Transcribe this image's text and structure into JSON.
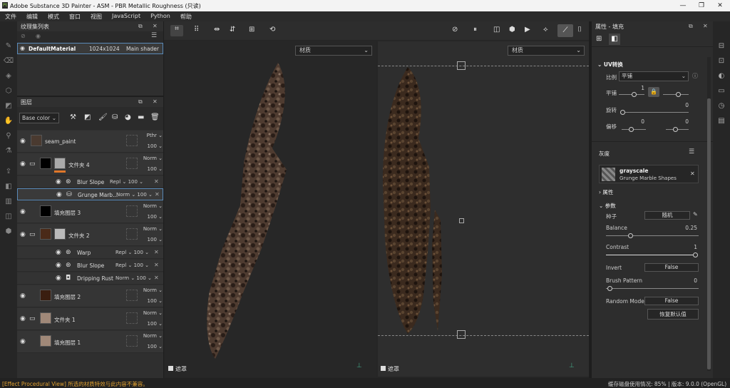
{
  "app": {
    "title": "Adobe Substance 3D Painter - ASM - PBR Metallic Roughness (只读)"
  },
  "menu": [
    "文件",
    "编辑",
    "模式",
    "窗口",
    "视图",
    "JavaScript",
    "Python",
    "帮助"
  ],
  "texture_set_panel": {
    "title": "纹理集列表",
    "row": {
      "name": "DefaultMaterial",
      "size": "1024x1024",
      "shader": "Main shader"
    }
  },
  "layers_panel": {
    "title": "图层",
    "channel": "Base color",
    "layers": [
      {
        "name": "seam_paint",
        "blend": "Pthr",
        "opacity": "100"
      },
      {
        "name": "文件夹 4",
        "blend": "Norm",
        "opacity": "100"
      },
      {
        "name": "Blur Slope",
        "blend": "Repl",
        "opacity": "100"
      },
      {
        "name": "Grunge Marb...",
        "blend": "Norm",
        "opacity": "100"
      },
      {
        "name": "填充图层 3",
        "blend": "Norm",
        "opacity": "100"
      },
      {
        "name": "文件夹 2",
        "blend": "Norm",
        "opacity": "100"
      },
      {
        "name": "Warp",
        "blend": "Repl",
        "opacity": "100"
      },
      {
        "name": "Blur Slope",
        "blend": "Repl",
        "opacity": "100"
      },
      {
        "name": "Dripping Rust",
        "blend": "Norm",
        "opacity": "100"
      },
      {
        "name": "填充图层 2",
        "blend": "Norm",
        "opacity": "100"
      },
      {
        "name": "文件夹 1",
        "blend": "Norm",
        "opacity": "100"
      },
      {
        "name": "填充图层 1",
        "blend": "Norm",
        "opacity": "100"
      }
    ]
  },
  "viewport": {
    "left_select": "材质",
    "right_select": "材质",
    "mask_label_left": "遮罩",
    "mask_label_right": "遮罩"
  },
  "properties": {
    "title": "属性 - 填充",
    "uv": {
      "title": "UV转换",
      "ratio_label": "比例",
      "ratio_value": "平铺",
      "tile_label": "平铺",
      "tile_value": "1",
      "rotate_label": "旋转",
      "rotate_value": "0",
      "offset_label": "偏移",
      "offset_a": "0",
      "offset_b": "0"
    },
    "gray": {
      "title": "灰度",
      "resource_name": "grayscale",
      "resource_sub": "Grunge Marble Shapes"
    },
    "attr_title": "属性",
    "params": {
      "title": "参数",
      "seed_label": "种子",
      "seed_value": "随机",
      "balance_label": "Balance",
      "balance_value": "0.25",
      "contrast_label": "Contrast",
      "contrast_value": "1",
      "invert_label": "Invert",
      "invert_value": "False",
      "brush_label": "Brush Pattern",
      "brush_value": "0",
      "random_label": "Random Mode",
      "random_value": "False",
      "reset_label": "恢复默认值"
    }
  },
  "status": {
    "left": "[Effect Procedural View] 所选的材质特效与此内容不兼容。",
    "right": "缓存磁盘使用情况:  85% | 版本: 9.0.0 (OpenGL)"
  },
  "colors": {
    "accent": "#e0772a",
    "status_warn": "#e0a030",
    "selection": "#5a8ab8"
  }
}
